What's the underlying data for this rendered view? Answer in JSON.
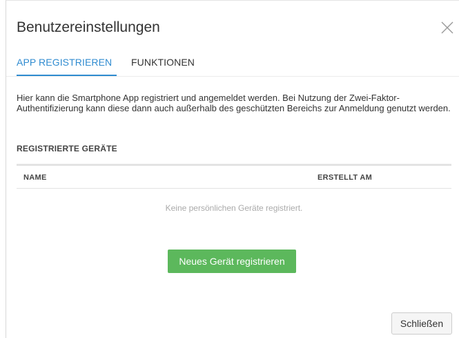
{
  "dialog": {
    "title": "Benutzereinstellungen",
    "close_icon": "close-icon"
  },
  "tabs": [
    {
      "label": "APP REGISTRIEREN",
      "active": true
    },
    {
      "label": "FUNKTIONEN",
      "active": false
    }
  ],
  "content": {
    "description": "Hier kann die Smartphone App registriert und angemeldet werden. Bei Nutzung der Zwei-Faktor-Authentifizierung kann diese dann auch außerhalb des geschützten Bereichs zur Anmeldung genutzt werden.",
    "section_title": "REGISTRIERTE GERÄTE",
    "table": {
      "columns": [
        "NAME",
        "ERSTELLT AM"
      ],
      "empty_text": "Keine persönlichen Geräte registriert."
    },
    "register_button": "Neues Gerät registrieren"
  },
  "footer": {
    "close_button": "Schließen"
  },
  "colors": {
    "accent": "#2f8bd0",
    "primary_button": "#5cb85c"
  }
}
